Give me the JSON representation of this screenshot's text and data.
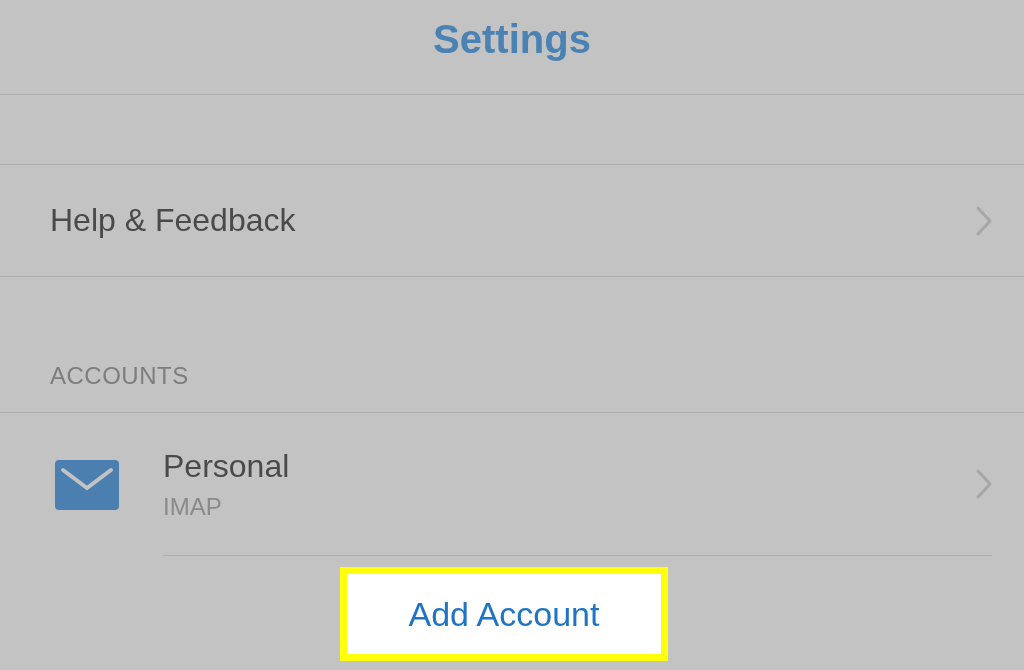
{
  "header": {
    "title": "Settings"
  },
  "rows": [
    {
      "label": "Help & Feedback"
    }
  ],
  "accounts_section": {
    "heading": "ACCOUNTS",
    "accounts": [
      {
        "name": "Personal",
        "type": "IMAP"
      }
    ]
  },
  "add_account": {
    "label": "Add Account",
    "highlighted": true
  }
}
